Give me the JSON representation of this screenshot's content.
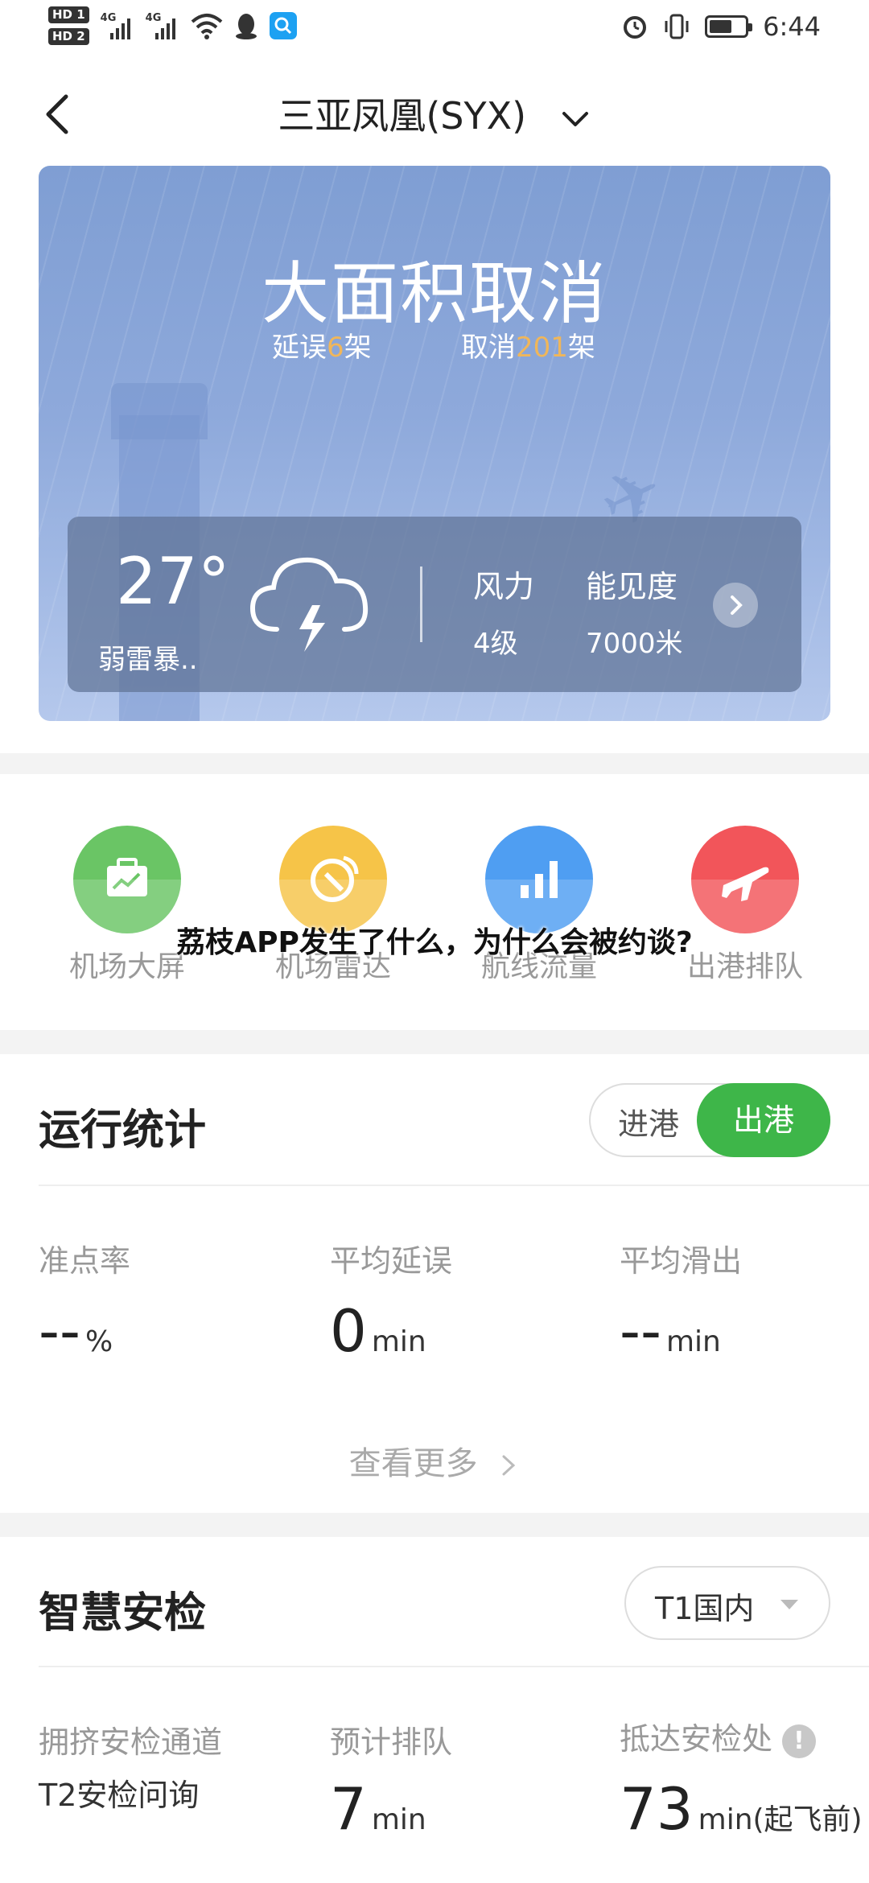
{
  "status_bar": {
    "hd1": "HD 1",
    "hd2": "HD 2",
    "net1": "4G",
    "net2": "4G",
    "time": "6:44"
  },
  "header": {
    "title": "三亚凤凰(SYX)"
  },
  "weather_card": {
    "headline": "大面积取消",
    "delay_prefix": "延误",
    "delay_count": "6",
    "delay_suffix": "架",
    "cancel_prefix": "取消",
    "cancel_count": "201",
    "cancel_suffix": "架",
    "temperature": "27°",
    "condition": "弱雷暴..",
    "wind_label": "风力",
    "wind_value": "4级",
    "visibility_label": "能见度",
    "visibility_value": "7000米",
    "accent_color": "#f0b65a"
  },
  "quick_actions": [
    {
      "label": "机场大屏",
      "icon": "briefcase-chart-icon",
      "color": "#6ac565"
    },
    {
      "label": "机场雷达",
      "icon": "radar-icon",
      "color": "#f6c448"
    },
    {
      "label": "航线流量",
      "icon": "bar-chart-icon",
      "color": "#4f9ef2"
    },
    {
      "label": "出港排队",
      "icon": "airplane-icon",
      "color": "#f2555a"
    }
  ],
  "overlay_caption": "荔枝APP发生了什么，为什么会被约谈?",
  "stats": {
    "title": "运行统计",
    "tab_in": "进港",
    "tab_out": "出港",
    "active_tab": "出港",
    "on_time_label": "准点率",
    "on_time_value": "--",
    "on_time_unit": "%",
    "avg_delay_label": "平均延误",
    "avg_delay_value": "0",
    "avg_delay_unit": "min",
    "avg_taxi_label": "平均滑出",
    "avg_taxi_value": "--",
    "avg_taxi_unit": "min",
    "see_more": "查看更多"
  },
  "security": {
    "title": "智慧安检",
    "terminal": "T1国内",
    "crowded_label": "拥挤安检通道",
    "crowded_value": "T2安检问询",
    "queue_label": "预计排队",
    "queue_value": "7",
    "queue_unit": "min",
    "arrive_label": "抵达安检处",
    "arrive_value": "73",
    "arrive_unit": "min(起飞前)"
  },
  "colors": {
    "green": "#3eb649"
  }
}
